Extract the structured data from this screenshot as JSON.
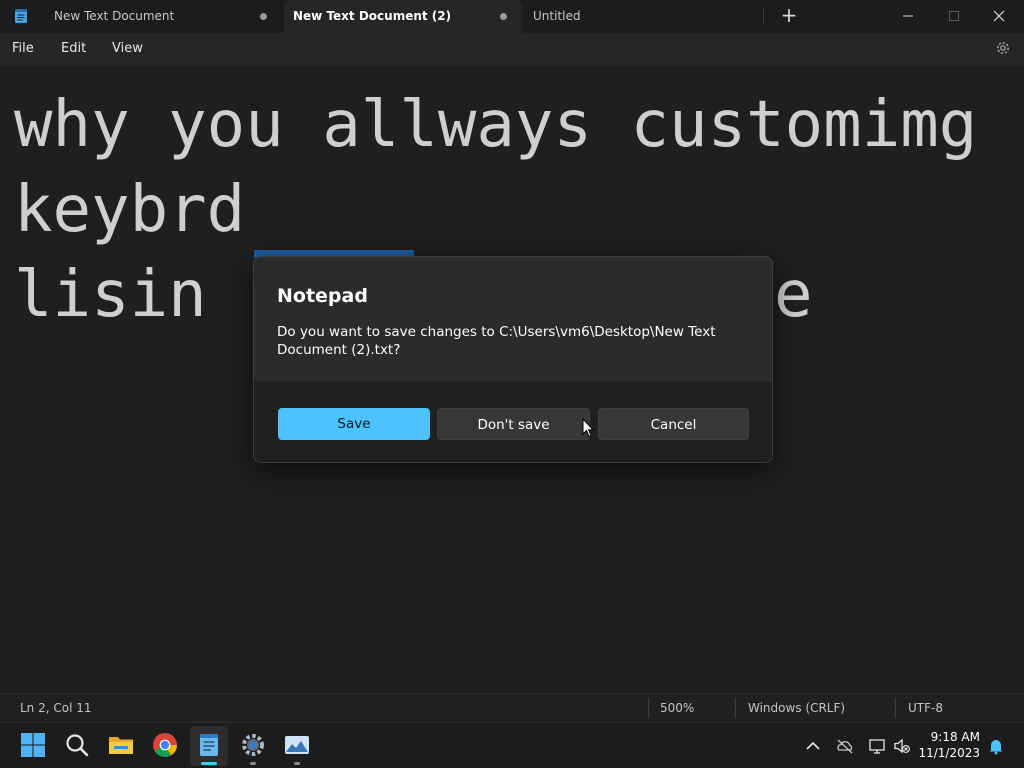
{
  "tabs": [
    {
      "label": "New Text Document",
      "unsaved": true,
      "active": false
    },
    {
      "label": "New Text Document (2)",
      "unsaved": true,
      "active": true
    },
    {
      "label": "Untitled",
      "unsaved": false,
      "active": false
    }
  ],
  "window_controls": {
    "new_tab": "+",
    "minimize": "—",
    "maximize": "▢",
    "close": "✕"
  },
  "menu": {
    "file": "File",
    "edit": "Edit",
    "view": "View"
  },
  "editor": {
    "lines": [
      "why you allways customimg",
      "keybrd",
      "lisin",
      "e"
    ]
  },
  "dialog": {
    "title": "Notepad",
    "message": "Do you want to save changes to C:\\Users\\vm6\\Desktop\\New Text Document (2).txt?",
    "buttons": {
      "save": "Save",
      "dont_save": "Don't save",
      "cancel": "Cancel"
    }
  },
  "statusbar": {
    "position": "Ln 2, Col 11",
    "zoom": "500%",
    "line_ending": "Windows (CRLF)",
    "encoding": "UTF-8"
  },
  "taskbar": {
    "icons": [
      "windows-start-icon",
      "search-icon",
      "file-explorer-icon",
      "chrome-icon",
      "notepad-icon",
      "settings-icon",
      "photos-icon"
    ],
    "time": "9:18 AM",
    "date": "11/1/2023"
  },
  "colors": {
    "accent": "#4cc2ff",
    "background": "#1f1f1f",
    "dialog": "#2b2b2b"
  }
}
